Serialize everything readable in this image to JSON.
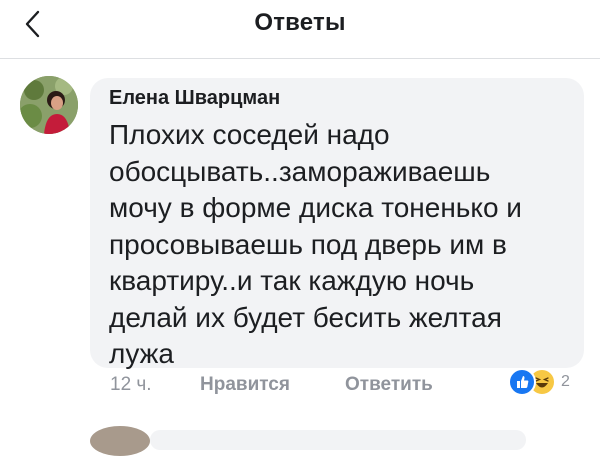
{
  "header": {
    "title": "Ответы",
    "back_icon": "chevron-left-icon"
  },
  "comment": {
    "author": "Елена Шварцман",
    "text": "Плохих соседей надо\nобосцывать..замораживаешь\nмочу в форме диска тоненько и\nпросовываешь под дверь им в\nквартиру..и так каждую ночь\nделай их будет бесить желтая\nлужа",
    "time": "12 ч.",
    "like_label": "Нравится",
    "reply_label": "Ответить",
    "reactions": {
      "icons": [
        "like-icon",
        "haha-icon"
      ],
      "count": "2"
    }
  },
  "colors": {
    "bubble": "#f2f3f5",
    "meta_text": "#90949c",
    "like_blue": "#1877f2",
    "haha_yellow": "#f7c844"
  }
}
